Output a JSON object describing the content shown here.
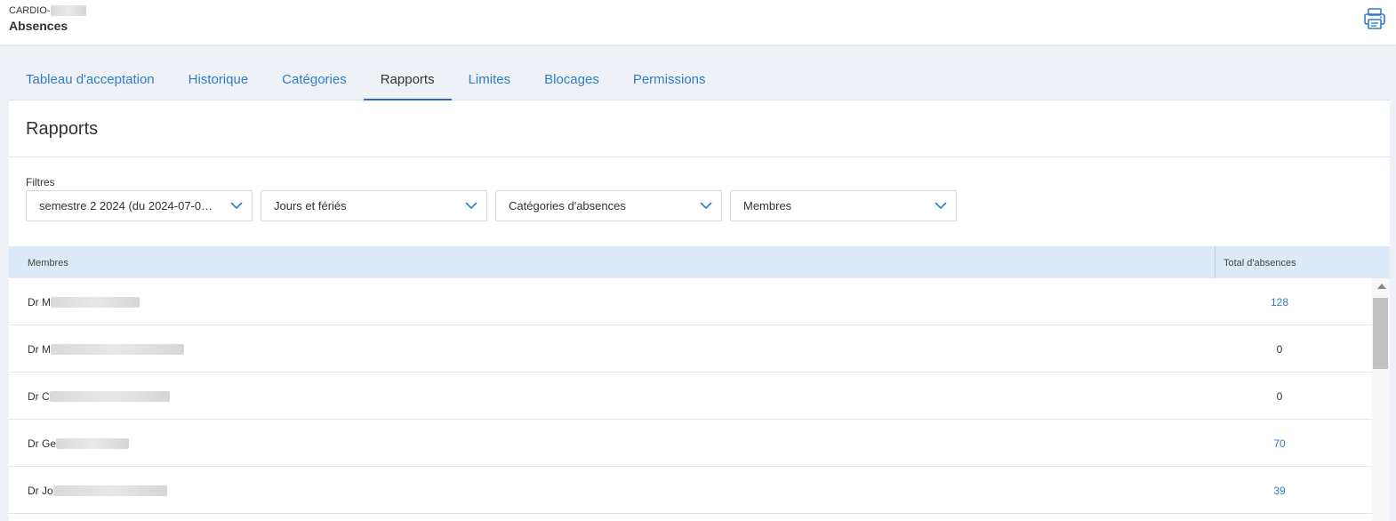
{
  "header": {
    "org_prefix": "CARDIO-",
    "title": "Absences",
    "print_icon": "printer-icon"
  },
  "tabs": [
    {
      "label": "Tableau d'acceptation",
      "active": false
    },
    {
      "label": "Historique",
      "active": false
    },
    {
      "label": "Catégories",
      "active": false
    },
    {
      "label": "Rapports",
      "active": true
    },
    {
      "label": "Limites",
      "active": false
    },
    {
      "label": "Blocages",
      "active": false
    },
    {
      "label": "Permissions",
      "active": false
    }
  ],
  "page": {
    "title": "Rapports",
    "filters_label": "Filtres",
    "filters": [
      {
        "value": "semestre 2 2024 (du 2024-07-0…",
        "icon": "chevron-down-icon"
      },
      {
        "value": "Jours et fériés",
        "icon": "chevron-down-icon"
      },
      {
        "value": "Catégories d'absences",
        "icon": "chevron-down-icon"
      },
      {
        "value": "Membres",
        "icon": "chevron-down-icon"
      }
    ]
  },
  "table": {
    "headers": {
      "members": "Membres",
      "total": "Total d'absences"
    },
    "rows": [
      {
        "name_prefix": "Dr M",
        "total": "128"
      },
      {
        "name_prefix": "Dr M",
        "total": "0"
      },
      {
        "name_prefix": "Dr C",
        "total": "0"
      },
      {
        "name_prefix": "Dr Ge",
        "total": "70"
      },
      {
        "name_prefix": "Dr Jo",
        "total": "39"
      }
    ]
  },
  "colors": {
    "accent": "#2f7dc9",
    "active_tab_underline": "#2f6bc4",
    "table_header_bg": "#dceaf7",
    "page_bg": "#eef2f6"
  }
}
